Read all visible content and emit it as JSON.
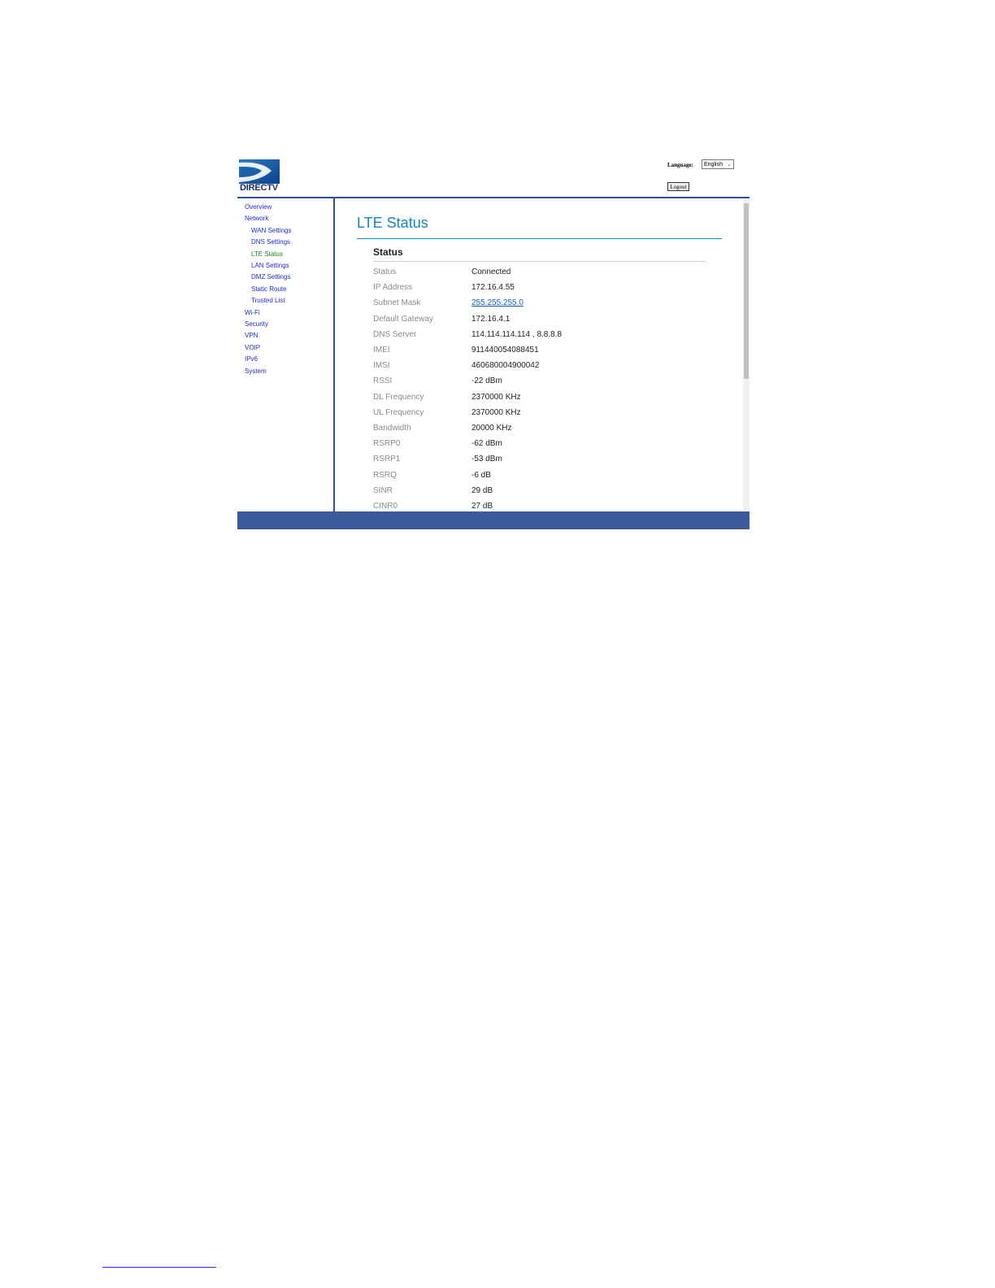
{
  "header": {
    "logo_text": "DIRECTV",
    "language_label": "Language:",
    "language_selected": "English",
    "logout_label": "Logout"
  },
  "sidebar": {
    "items": [
      {
        "label": "Overview",
        "level": 0,
        "active": false
      },
      {
        "label": "Network",
        "level": 0,
        "active": false
      },
      {
        "label": "WAN Settings",
        "level": 1,
        "active": false
      },
      {
        "label": "DNS Settings",
        "level": 1,
        "active": false
      },
      {
        "label": "LTE Status",
        "level": 1,
        "active": true
      },
      {
        "label": "LAN Settings",
        "level": 1,
        "active": false
      },
      {
        "label": "DMZ Settings",
        "level": 1,
        "active": false
      },
      {
        "label": "Static Route",
        "level": 1,
        "active": false
      },
      {
        "label": "Trusted List",
        "level": 1,
        "active": false
      },
      {
        "label": "Wi-Fi",
        "level": 0,
        "active": false
      },
      {
        "label": "Security",
        "level": 0,
        "active": false
      },
      {
        "label": "VPN",
        "level": 0,
        "active": false
      },
      {
        "label": "VOIP",
        "level": 0,
        "active": false
      },
      {
        "label": "IPv6",
        "level": 0,
        "active": false
      },
      {
        "label": "System",
        "level": 0,
        "active": false
      }
    ]
  },
  "main": {
    "title": "LTE Status",
    "section_title": "Status",
    "rows": [
      {
        "label": "Status",
        "value": "Connected"
      },
      {
        "label": "IP Address",
        "value": "172.16.4.55"
      },
      {
        "label": "Subnet Mask",
        "value": "255.255.255.0",
        "link": true
      },
      {
        "label": "Default Gateway",
        "value": "172.16.4.1"
      },
      {
        "label": "DNS Server",
        "value": "114.114.114.114 , 8.8.8.8"
      },
      {
        "label": "IMEI",
        "value": "911440054088451"
      },
      {
        "label": "IMSI",
        "value": "460680004900042"
      },
      {
        "label": "RSSI",
        "value": "-22 dBm"
      },
      {
        "label": "DL Frequency",
        "value": "2370000 KHz"
      },
      {
        "label": "UL Frequency",
        "value": "2370000 KHz"
      },
      {
        "label": "Bandwidth",
        "value": "20000 KHz"
      },
      {
        "label": "RSRP0",
        "value": "-62 dBm"
      },
      {
        "label": "RSRP1",
        "value": "-53 dBm"
      },
      {
        "label": "RSRQ",
        "value": "-6 dB"
      },
      {
        "label": "SINR",
        "value": "29 dB"
      },
      {
        "label": "CINR0",
        "value": "27 dB"
      }
    ]
  },
  "colors": {
    "accent": "#1186c6",
    "nav_link": "#1b2ccf",
    "nav_active": "#0a8a18",
    "frame_blue": "#2f4f9a",
    "footer_blue": "#3b5a9c"
  },
  "icons": {
    "logo": "directv-logo-icon",
    "select_arrow": "chevron-down-icon"
  }
}
